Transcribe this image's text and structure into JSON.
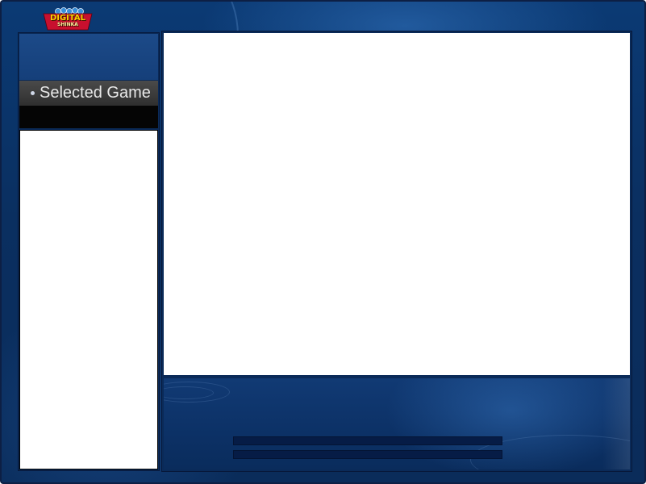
{
  "logo": {
    "line1": "DIGITAL",
    "line2": "SHINKA",
    "colors": {
      "text": "#ffd000",
      "red": "#c8102e",
      "blue": "#3a8fd8"
    }
  },
  "sidebar": {
    "header_label": "Selected Game",
    "bullet_icon": "bullet-dot-icon"
  },
  "theme": {
    "frame_blue": "#0b3a74",
    "panel_dark": "#0a2a58",
    "header_gray": "#3a3a3a",
    "content_white": "#ffffff",
    "bar_navy": "#061c46"
  }
}
